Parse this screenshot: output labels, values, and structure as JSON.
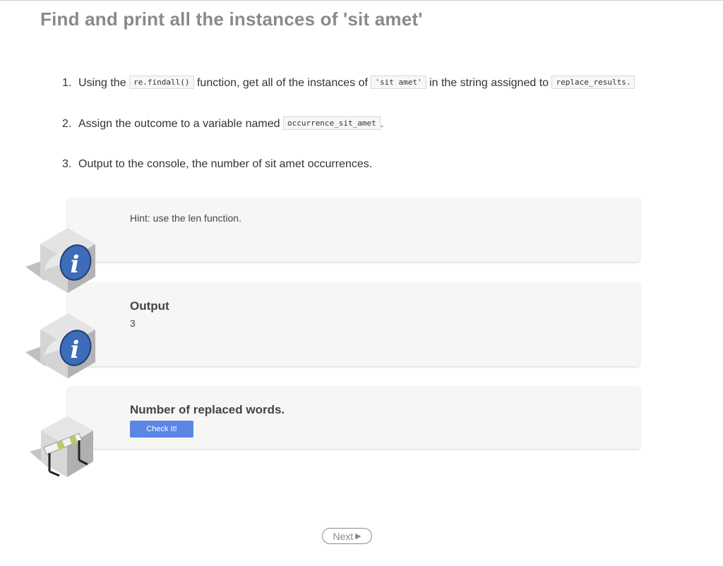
{
  "page": {
    "title": "Find and print all the instances of 'sit amet'"
  },
  "steps": [
    {
      "number": "1.",
      "parts": [
        "Using the ",
        "re.findall()",
        " function, get all of the instances of ",
        "'sit amet'",
        " in the string assigned to ",
        "replace_results."
      ]
    },
    {
      "number": "2.",
      "parts": [
        "Assign the outcome to a variable named ",
        "occurrence_sit_amet",
        "."
      ]
    },
    {
      "number": "3.",
      "parts": [
        "Output to the console, the number of sit amet occurrences."
      ]
    }
  ],
  "hint": {
    "text": "Hint: use the len function.",
    "icon": "info-cube-icon"
  },
  "output": {
    "label": "Output",
    "value": "3",
    "icon": "info-cube-icon"
  },
  "check": {
    "title": "Number of replaced words.",
    "button_label": "Check It!",
    "icon": "hurdle-cube-icon"
  },
  "navigation": {
    "next_label": "Next",
    "next_icon": "play-arrow-icon"
  },
  "colors": {
    "title": "#8a8a8a",
    "card_background": "#f6f7f5",
    "check_button": "#5b86e5",
    "info_circle": "#3d6cb9"
  }
}
